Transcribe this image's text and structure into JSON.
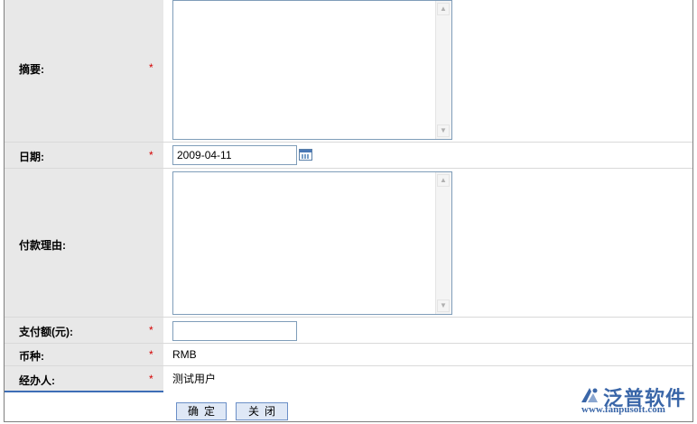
{
  "fields": {
    "summary": {
      "label": "摘要:",
      "required": "*"
    },
    "date": {
      "label": "日期:",
      "required": "*",
      "value": "2009-04-11"
    },
    "reason": {
      "label": "付款理由:",
      "required": "*"
    },
    "amount": {
      "label": "支付额(元):",
      "required": "*",
      "value": ""
    },
    "currency": {
      "label": "币种:",
      "required": "*",
      "value": "RMB"
    },
    "handler": {
      "label": "经办人:",
      "required": "*",
      "value": "测试用户"
    }
  },
  "buttons": {
    "confirm": "确定",
    "close": "关闭"
  },
  "logo": {
    "name": "泛普软件",
    "url": "www.fanpusoft.com"
  },
  "colors": {
    "label_bg": "#e8e8e8",
    "required": "#d40000",
    "accent": "#3d6eb6"
  }
}
